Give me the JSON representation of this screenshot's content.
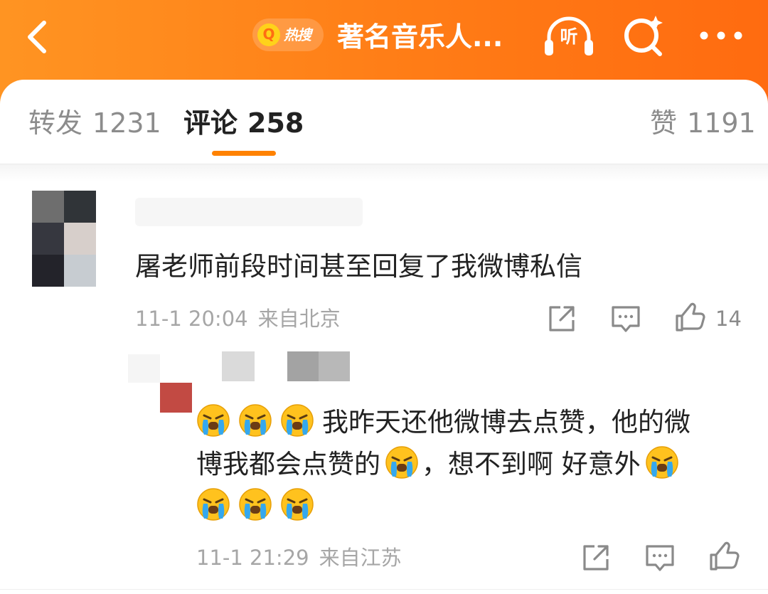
{
  "header": {
    "search_badge": "热搜",
    "search_glyph": "Q",
    "title": "著名音乐人...",
    "listen_label": "听",
    "colors": {
      "gradient_start": "#ff9422",
      "gradient_end": "#ff6b10"
    }
  },
  "tabs": [
    {
      "label": "转发",
      "count": "1231"
    },
    {
      "label": "评论",
      "count": "258"
    },
    {
      "label": "赞",
      "count": "1191"
    }
  ],
  "active_tab": "评论",
  "accent_color": "#ff8200",
  "comment": {
    "text": "屠老师前段时间甚至回复了我微博私信",
    "time": "11-1 20:04",
    "source": "来自北京",
    "likes": "14"
  },
  "reply": {
    "line1": "我昨天还他微博去点赞，他的微",
    "line2a": "博我都会点赞的",
    "line2b": "，想不到啊 好意外",
    "emoji_name": "crying-emoji",
    "time": "11-1 21:29",
    "source": "来自江苏"
  }
}
